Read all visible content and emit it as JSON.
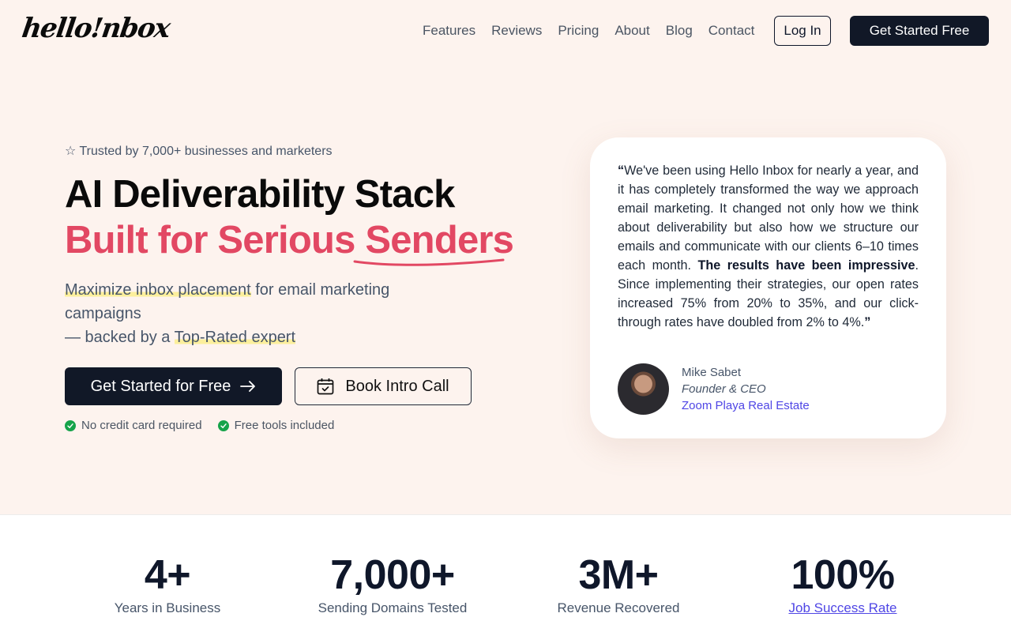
{
  "header": {
    "logo": "hello!nbox",
    "nav": [
      "Features",
      "Reviews",
      "Pricing",
      "About",
      "Blog",
      "Contact"
    ],
    "login_label": "Log In",
    "start_label": "Get Started Free"
  },
  "hero": {
    "trusted": "☆ Trusted by 7,000+ businesses and marketers",
    "headline_line1": "AI Deliverability Stack",
    "headline_line2": "Built for Serious Senders",
    "sub_hl1": "Maximize inbox placement",
    "sub_rest1": " for email marketing campaigns",
    "sub_prefix2": "— backed by a ",
    "sub_hl2": "Top-Rated expert",
    "cta_primary": "Get Started for Free",
    "cta_secondary": "Book Intro Call",
    "checks": [
      "No credit card required",
      "Free tools included"
    ]
  },
  "testimonial": {
    "open_quote": "“",
    "text_part1": "We've been using Hello Inbox for nearly a year, and it has completely transformed the way we approach email marketing. It changed not only how we think about deliverability but also how we structure our emails and communicate with our clients 6–10 times each month. ",
    "text_bold": "The results have been impressive",
    "text_part2": ". Since implementing their strategies, our open rates increased 75% from 20% to 35%, and our click-through rates have doubled from 2% to 4%.",
    "close_quote": "”",
    "author_name": "Mike Sabet",
    "author_role": "Founder & CEO",
    "author_company": "Zoom Playa Real Estate"
  },
  "stats": [
    {
      "value": "4+",
      "label": "Years in Business"
    },
    {
      "value": "7,000+",
      "label": "Sending Domains Tested"
    },
    {
      "value": "3M+",
      "label": "Revenue Recovered"
    },
    {
      "value": "100%",
      "label": "Job Success Rate"
    }
  ],
  "colors": {
    "accent": "#e24863",
    "dark": "#111827",
    "link": "#4f46e5",
    "background": "#fdf3ee",
    "highlight": "#fcef9c",
    "check": "#16a34a"
  }
}
